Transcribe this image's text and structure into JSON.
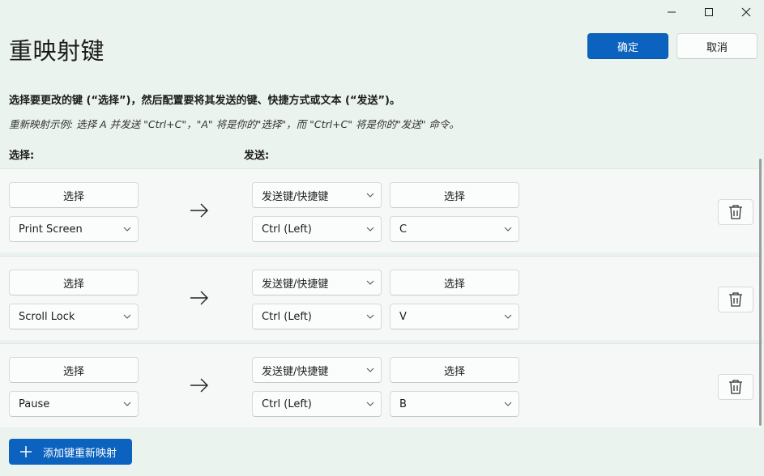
{
  "window": {
    "title": "重映射键",
    "minimize_glyph": "—",
    "maximize_glyph": "☐",
    "close_glyph": "✕"
  },
  "actions": {
    "ok_label": "确定",
    "cancel_label": "取消"
  },
  "instruction": "选择要更改的键 (“选择”)，然后配置要将其发送的键、快捷方式或文本 (“发送”)。",
  "example": "重新映射示例: 选择 A 并发送 \"Ctrl+C\"，\"A\" 将是你的\"选择\"，而 \"Ctrl+C\" 将是你的\"发送\" 命令。",
  "columns": {
    "select": "选择:",
    "send": "发送:"
  },
  "select_button_label": "选择",
  "rows": [
    {
      "select_button": "选择",
      "source_key": "Print Screen",
      "send_type": "发送键/快捷键",
      "target_select_button": "选择",
      "modifier": "Ctrl (Left)",
      "target_key": "C"
    },
    {
      "select_button": "选择",
      "source_key": "Scroll Lock",
      "send_type": "发送键/快捷键",
      "target_select_button": "选择",
      "modifier": "Ctrl (Left)",
      "target_key": "V"
    },
    {
      "select_button": "选择",
      "source_key": "Pause",
      "send_type": "发送键/快捷键",
      "target_select_button": "选择",
      "modifier": "Ctrl (Left)",
      "target_key": "B"
    }
  ],
  "add_button_label": "添加键重新映射",
  "icons": {
    "arrow": "arrow-right-icon",
    "delete": "trash-icon",
    "chevron": "chevron-down-icon",
    "add": "plus-icon"
  },
  "colors": {
    "accent": "#0b63bf",
    "background": "#eaf3ee"
  }
}
